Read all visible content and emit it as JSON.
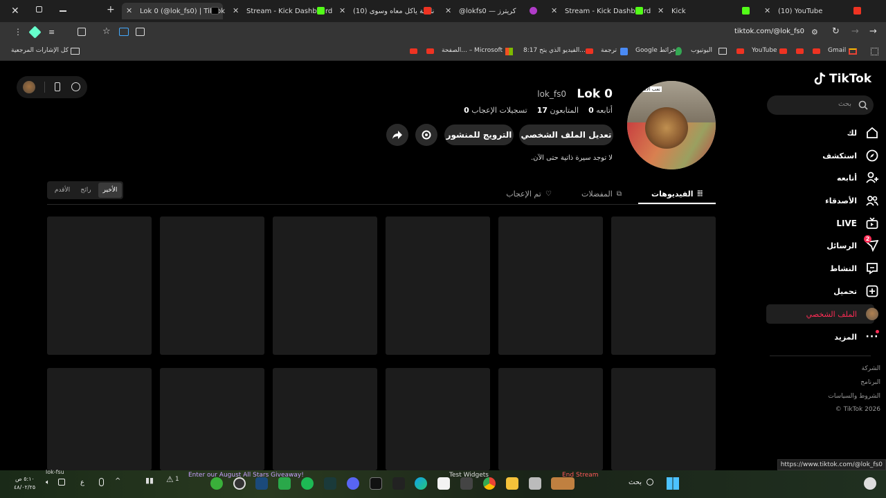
{
  "browser": {
    "tabs": [
      {
        "label": "Lok 0 (@lok_fs0) | TikTok",
        "active": true
      },
      {
        "label": "Stream - Kick Dashboard"
      },
      {
        "label": "(10) نادانة ياكل معاه وسوى"
      },
      {
        "label": "@lokfs0 — كريترز"
      },
      {
        "label": "Stream - Kick Dashboard"
      },
      {
        "label": "Kick"
      },
      {
        "label": "(10) YouTube"
      }
    ],
    "address": "tiktok.com/@lok_fs0",
    "bookmarks": {
      "all_bookmarks": "كل الإشارات المرجعية",
      "items": [
        "الصفحة... – Microsoft",
        "8:17 الفيديو الذي يتح...",
        "ترجمة",
        "Google خرائط",
        "اليوتيوب",
        "YouTube",
        "Gmail"
      ]
    }
  },
  "sidebar": {
    "logo": "TikTok",
    "search_placeholder": "بحث",
    "nav": [
      {
        "label": "لك",
        "icon": "home-icon"
      },
      {
        "label": "استكشف",
        "icon": "compass-icon"
      },
      {
        "label": "أتابعه",
        "icon": "following-icon"
      },
      {
        "label": "الأصدقاء",
        "icon": "friends-icon"
      },
      {
        "label": "LIVE",
        "icon": "live-icon"
      },
      {
        "label": "الرسائل",
        "icon": "messages-icon",
        "badge": "2"
      },
      {
        "label": "النشاط",
        "icon": "activity-icon"
      },
      {
        "label": "تحميل",
        "icon": "upload-icon"
      },
      {
        "label": "الملف الشخصي",
        "icon": "avatar",
        "active": true
      },
      {
        "label": "المزيد",
        "icon": "more-icon"
      }
    ],
    "footer": {
      "company": "الشركة",
      "program": "البرنامج",
      "terms": "الشروط والسياسات",
      "copyright": "© TikTok 2026"
    }
  },
  "profile": {
    "display_name": "Lok 0",
    "username": "lok_fs0",
    "stats": {
      "following_label": "أتابعه",
      "following": "0",
      "followers_label": "المتابعون",
      "followers": "17",
      "likes_label": "تسجيلات الإعجاب",
      "likes": "0"
    },
    "edit_button": "تعديل الملف الشخصي",
    "promote_button": "الترويج للمنشور",
    "bio": "لا توجد سيرة ذاتية حتى الآن.",
    "avatar_caption": "تعب الاسد"
  },
  "tabs": {
    "videos": "الفيديوهات",
    "favorites": "المفضلات",
    "liked": "تم الإعجاب"
  },
  "sort": {
    "latest": "الأخير",
    "popular": "رائج",
    "oldest": "الأقدم"
  },
  "status_url": "https://www.tiktok.com/@lok_fs0",
  "taskbar": {
    "stream_user": "lok-fsu",
    "time": "٥:١٠ ص",
    "date": "٤٨/٠٢/٢٥",
    "lang": "ع",
    "notice": "1",
    "banner": "Enter our August All Stars Giveaway!",
    "widgets": "Test Widgets",
    "end_stream": "End Stream",
    "search": "بحث"
  },
  "colors": {
    "accent": "#fe2c55",
    "chrome": "#353535",
    "card": "#1c1c1c"
  }
}
